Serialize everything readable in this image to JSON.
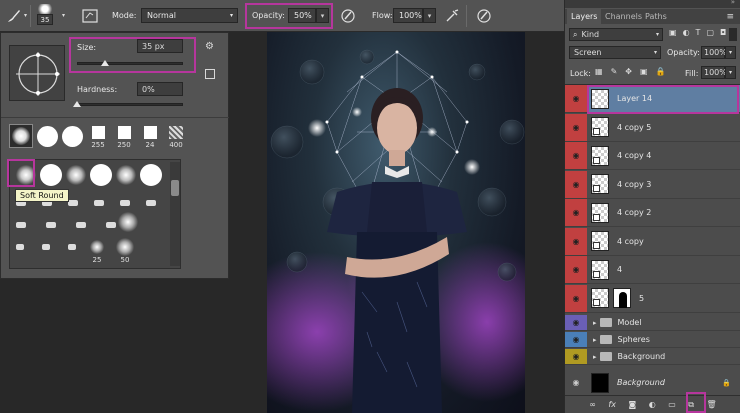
{
  "options_bar": {
    "brush_size": "35",
    "mode_label": "Mode:",
    "mode_value": "Normal",
    "opacity_label": "Opacity:",
    "opacity_value": "50%",
    "flow_label": "Flow:",
    "flow_value": "100%"
  },
  "brush_picker": {
    "size_label": "Size:",
    "size_value": "35 px",
    "hardness_label": "Hardness:",
    "hardness_value": "0%",
    "size_slider": 0.26,
    "hardness_slider": 0.0,
    "top_presets": [
      "",
      "",
      "",
      "255",
      "250",
      "24",
      "400"
    ],
    "tooltip": "Soft Round",
    "grid_labels": [
      "25",
      "50"
    ]
  },
  "layers_panel": {
    "tabs": [
      "Layers",
      "Channels",
      "Paths"
    ],
    "filter_kind": "Kind",
    "blend_mode": "Screen",
    "opacity_label": "Opacity:",
    "opacity_value": "100%",
    "lock_label": "Lock:",
    "fill_label": "Fill:",
    "fill_value": "100%",
    "layers": [
      {
        "name": "Layer 14",
        "eye_color": "#c14040",
        "selected": true
      },
      {
        "name": "4 copy 5",
        "eye_color": "#c14040",
        "selected": false
      },
      {
        "name": "4 copy 4",
        "eye_color": "#c14040",
        "selected": false
      },
      {
        "name": "4 copy 3",
        "eye_color": "#c14040",
        "selected": false
      },
      {
        "name": "4 copy 2",
        "eye_color": "#c14040",
        "selected": false
      },
      {
        "name": "4 copy",
        "eye_color": "#c14040",
        "selected": false
      },
      {
        "name": "4",
        "eye_color": "#c14040",
        "selected": false
      },
      {
        "name": "5",
        "eye_color": "#c14040",
        "selected": false
      }
    ],
    "groups": [
      {
        "name": "Model",
        "eye_color": "#6a5fb5"
      },
      {
        "name": "Spheres",
        "eye_color": "#4a7fb8"
      },
      {
        "name": "Background",
        "eye_color": "#b09a22"
      }
    ],
    "background_layer": "Background",
    "bottom_icons": [
      "link-icon",
      "fx-icon",
      "mask-icon",
      "adjustment-icon",
      "folder-icon",
      "new-layer-icon",
      "trash-icon"
    ]
  },
  "colors": {
    "highlight": "#b6369d",
    "selected_row": "#5f7ea2"
  }
}
